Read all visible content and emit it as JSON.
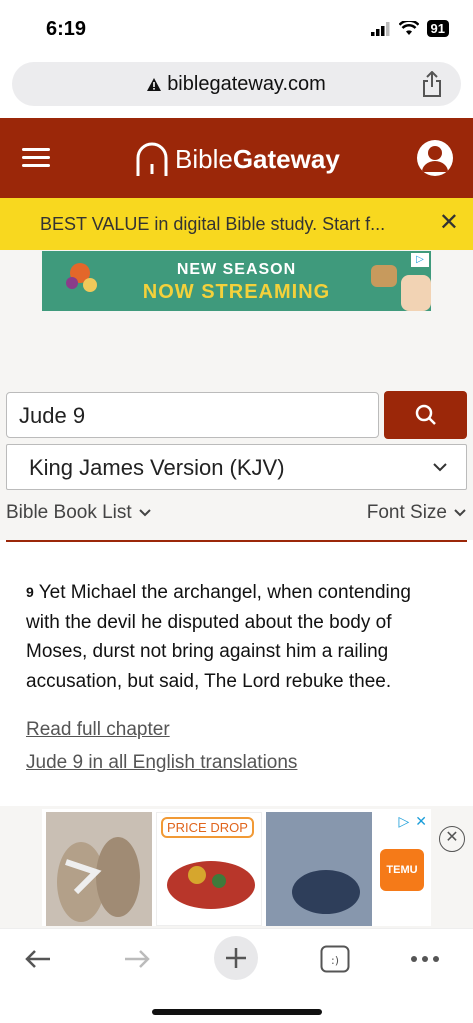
{
  "status_bar": {
    "time": "6:19",
    "battery": "91"
  },
  "browser": {
    "url": "biblegateway.com"
  },
  "header": {
    "brand_light": "Bible",
    "brand_bold": "Gateway"
  },
  "promo": {
    "text": "BEST VALUE in digital Bible study. Start f...",
    "close": "✕"
  },
  "top_ad": {
    "line1": "NEW SEASON",
    "line2": "NOW STREAMING"
  },
  "search": {
    "value": "Jude 9"
  },
  "version": {
    "selected": "King James Version (KJV)"
  },
  "controls": {
    "book_list": "Bible Book List",
    "font_size": "Font Size"
  },
  "passage": {
    "verse_number": "9",
    "verse_text": "Yet Michael the archangel, when contending with the devil he disputed about the body of Moses, durst not bring against him a railing accusation, but said, The Lord rebuke thee.",
    "link_chapter": "Read full chapter",
    "link_translations": "Jude 9 in all English translations"
  },
  "bottom_ad": {
    "price_drop": "PRICE DROP",
    "temu": "TEMU"
  },
  "colors": {
    "brand": "#9b2709",
    "promo": "#f8d81f"
  }
}
